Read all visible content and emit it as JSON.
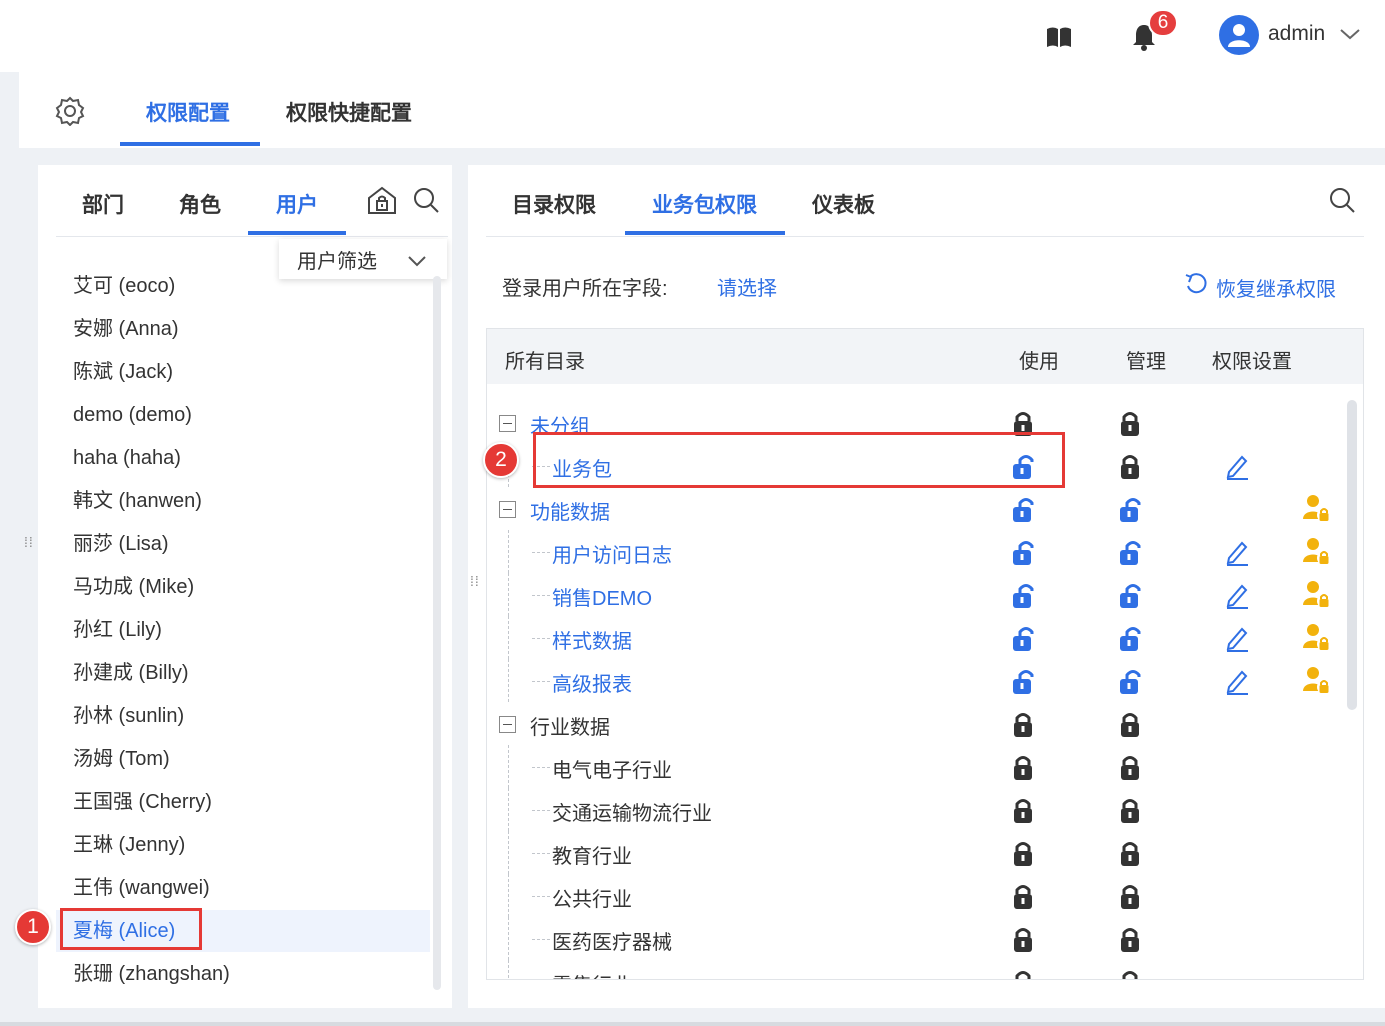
{
  "topbar": {
    "notification_count": "6",
    "username": "admin",
    "icons": [
      "book-icon",
      "bell-icon",
      "user-avatar-icon",
      "chevron-down-icon"
    ]
  },
  "main_tabs": [
    {
      "label": "权限配置",
      "active": true
    },
    {
      "label": "权限快捷配置",
      "active": false
    }
  ],
  "left": {
    "tabs": [
      {
        "label": "部门",
        "active": false
      },
      {
        "label": "角色",
        "active": false
      },
      {
        "label": "用户",
        "active": true
      }
    ],
    "filter_label": "用户筛选",
    "users": [
      "艾可 (eoco)",
      "安娜 (Anna)",
      "陈斌 (Jack)",
      "demo (demo)",
      "haha (haha)",
      "韩文 (hanwen)",
      "丽莎 (Lisa)",
      "马功成 (Mike)",
      "孙红 (Lily)",
      "孙建成 (Billy)",
      "孙林 (sunlin)",
      "汤姆 (Tom)",
      "王国强 (Cherry)",
      "王琳 (Jenny)",
      "王伟 (wangwei)",
      "夏梅 (Alice)",
      "张珊 (zhangshan)"
    ],
    "selected_user": "夏梅 (Alice)"
  },
  "right": {
    "tabs": [
      {
        "label": "目录权限",
        "active": false
      },
      {
        "label": "业务包权限",
        "active": true
      },
      {
        "label": "仪表板",
        "active": false
      }
    ],
    "login_field_label": "登录用户所在字段:",
    "login_field_value": "请选择",
    "restore_label": "恢复继承权限",
    "table": {
      "headers": {
        "name": "所有目录",
        "use": "使用",
        "manage": "管理",
        "settings": "权限设置"
      },
      "rows": [
        {
          "name": "未分组",
          "level": 0,
          "toggle": true,
          "link": true,
          "use": "locked",
          "manage": "locked",
          "edit": false,
          "user_lock": false
        },
        {
          "name": "业务包",
          "level": 1,
          "toggle": false,
          "link": true,
          "use": "unlocked",
          "manage": "locked",
          "edit": true,
          "user_lock": false
        },
        {
          "name": "功能数据",
          "level": 0,
          "toggle": true,
          "link": true,
          "use": "unlocked",
          "manage": "unlocked",
          "edit": false,
          "user_lock": true
        },
        {
          "name": "用户访问日志",
          "level": 1,
          "toggle": false,
          "link": true,
          "use": "unlocked",
          "manage": "unlocked",
          "edit": true,
          "user_lock": true
        },
        {
          "name": "销售DEMO",
          "level": 1,
          "toggle": false,
          "link": true,
          "use": "unlocked",
          "manage": "unlocked",
          "edit": true,
          "user_lock": true
        },
        {
          "name": "样式数据",
          "level": 1,
          "toggle": false,
          "link": true,
          "use": "unlocked",
          "manage": "unlocked",
          "edit": true,
          "user_lock": true
        },
        {
          "name": "高级报表",
          "level": 1,
          "toggle": false,
          "link": true,
          "use": "unlocked",
          "manage": "unlocked",
          "edit": true,
          "user_lock": true
        },
        {
          "name": "行业数据",
          "level": 0,
          "toggle": true,
          "link": false,
          "use": "locked",
          "manage": "locked",
          "edit": false,
          "user_lock": false
        },
        {
          "name": "电气电子行业",
          "level": 1,
          "toggle": false,
          "link": false,
          "use": "locked",
          "manage": "locked",
          "edit": false,
          "user_lock": false
        },
        {
          "name": "交通运输物流行业",
          "level": 1,
          "toggle": false,
          "link": false,
          "use": "locked",
          "manage": "locked",
          "edit": false,
          "user_lock": false
        },
        {
          "name": "教育行业",
          "level": 1,
          "toggle": false,
          "link": false,
          "use": "locked",
          "manage": "locked",
          "edit": false,
          "user_lock": false
        },
        {
          "name": "公共行业",
          "level": 1,
          "toggle": false,
          "link": false,
          "use": "locked",
          "manage": "locked",
          "edit": false,
          "user_lock": false
        },
        {
          "name": "医药医疗器械",
          "level": 1,
          "toggle": false,
          "link": false,
          "use": "locked",
          "manage": "locked",
          "edit": false,
          "user_lock": false
        },
        {
          "name": "零售行业",
          "level": 1,
          "toggle": false,
          "link": false,
          "use": "locked",
          "manage": "locked",
          "edit": false,
          "user_lock": false
        }
      ]
    }
  },
  "annotations": [
    "1",
    "2"
  ],
  "colors": {
    "accent": "#2f6fe4",
    "annotation": "#e53935",
    "user_lock": "#f2b20d",
    "lock": "#333333"
  }
}
